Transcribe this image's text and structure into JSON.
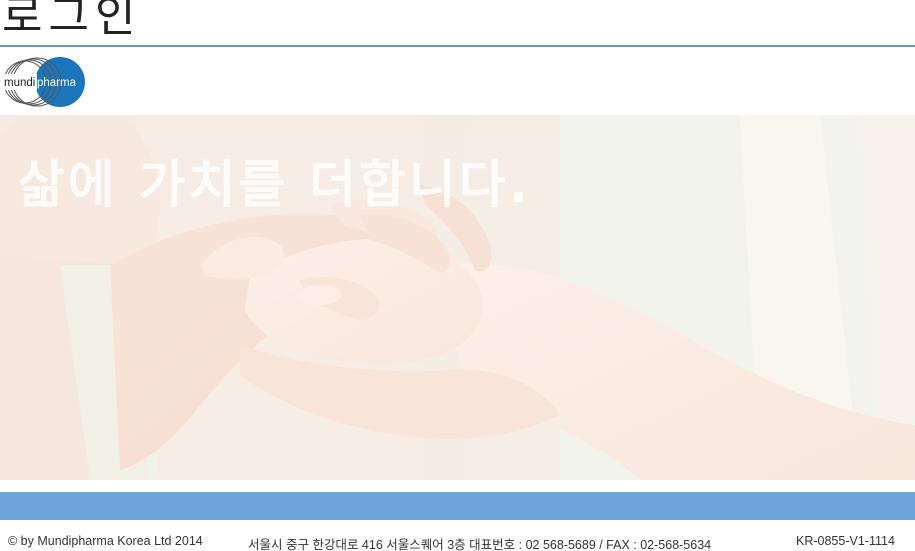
{
  "header": {
    "title": "로그인"
  },
  "logo": {
    "text_left": "mundi",
    "text_right": "pharma",
    "brand_color": "#1b75bc"
  },
  "hero": {
    "tagline": "삶에 가치를 더합니다.",
    "image_description_icon": "holding-hands-image"
  },
  "colors": {
    "accent_line": "#5b9bd5",
    "band": "#6fa6d9"
  },
  "footer": {
    "copyright": "© by Mundipharma Korea Ltd 2014",
    "address": "서울시 중구 한강대로 416 서울스퀘어 3층 대표번호 : 02 568-5689 / FAX : 02-568-5634",
    "code": "KR-0855-V1-1114"
  }
}
